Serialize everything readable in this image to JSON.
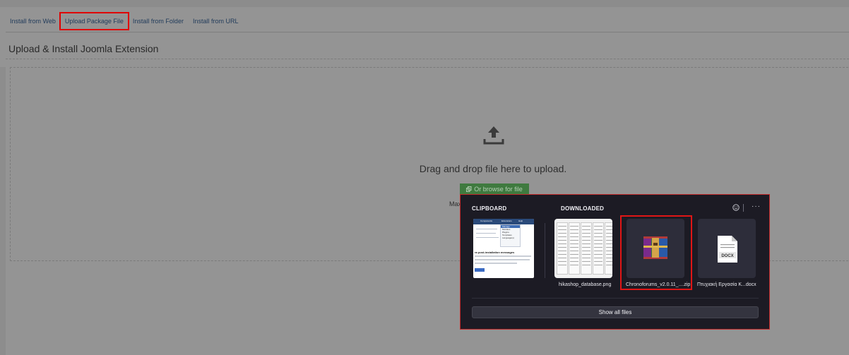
{
  "tabs": [
    {
      "label": "Install from Web"
    },
    {
      "label": "Upload Package File",
      "active": true
    },
    {
      "label": "Install from Folder"
    },
    {
      "label": "Install from URL"
    }
  ],
  "page_title": "Upload & Install Joomla Extension",
  "dropzone": {
    "icon": "upload-icon",
    "text": "Drag and drop file here to upload.",
    "browse_label": "Or browse for file",
    "max_text": "Max"
  },
  "panel": {
    "clipboard_label": "CLIPBOARD",
    "downloaded_label": "DOWNLOADED",
    "clipboard_thumb": {
      "menu_bar": [
        "Components",
        "Extensions",
        "Help"
      ],
      "menu_items": [
        "Manage",
        "Modules",
        "Plugins",
        "Templates",
        "Language(s)"
      ],
      "message": "ra post-installation messages"
    },
    "files": [
      {
        "name": "hikashop_database.png",
        "icon": "image-thumbnail"
      },
      {
        "name": "Chronoforums_v2.0.11_....zip",
        "icon": "winrar-archive-icon",
        "selected": true
      },
      {
        "name": "Πτυχιακή Εργασία Κ...docx",
        "icon": "docx-file-icon",
        "badge": "DOCX"
      }
    ],
    "show_all_label": "Show all files"
  },
  "colors": {
    "selection": "#e01616",
    "panel_bg": "#1c1b24",
    "browse_btn": "#3f7a3f"
  }
}
